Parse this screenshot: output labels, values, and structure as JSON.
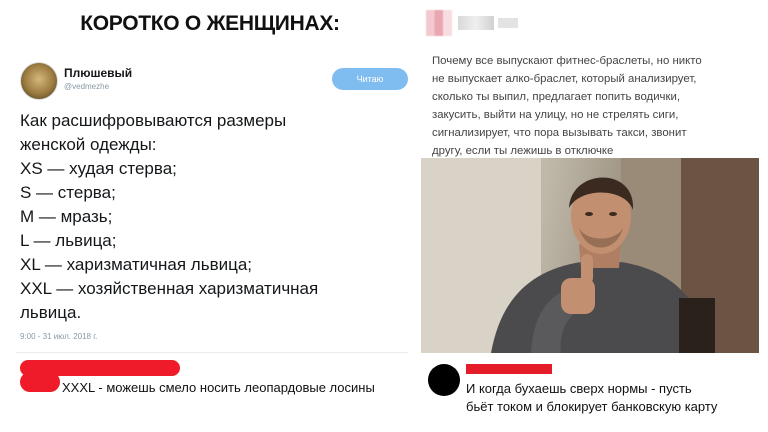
{
  "main_title": "КОРОТКО О ЖЕНЩИНАХ:",
  "tweet": {
    "display_name": "Плюшевый",
    "handle": "@vedmezhe",
    "follow_label": "Читаю",
    "body_lines": [
      "Как расшифровываются размеры",
      "женской одежды:",
      "XS — худая стерва;",
      "S — стерва;",
      "M — мразь;",
      "L — львица;",
      "XL — харизматичная львица;",
      "XXL — хозяйственная харизматичная",
      "львица."
    ],
    "timestamp": "9:00 - 31 июл. 2018 г."
  },
  "post": {
    "text_lines": [
      "Почему все выпускают фитнес-браслеты, но никто",
      "не выпускает алко-браслет, который анализирует,",
      "сколько ты выпил, предлагает попить водички,",
      "закусить, выйти на улицу, но не стрелять сиги,",
      "сигнализирует, что пора вызывать такси, звонит",
      "другу, если ты лежишь в отключке"
    ]
  },
  "comments": {
    "left": "XXXL - можешь смело носить леопардовые лосины",
    "right_lines": [
      "И когда бухаешь сверх нормы - пусть",
      "бьёт током и блокирует банковскую карту"
    ]
  },
  "colors": {
    "follow_button": "#7fbdf0",
    "redaction_red": "#ef1a2a"
  }
}
